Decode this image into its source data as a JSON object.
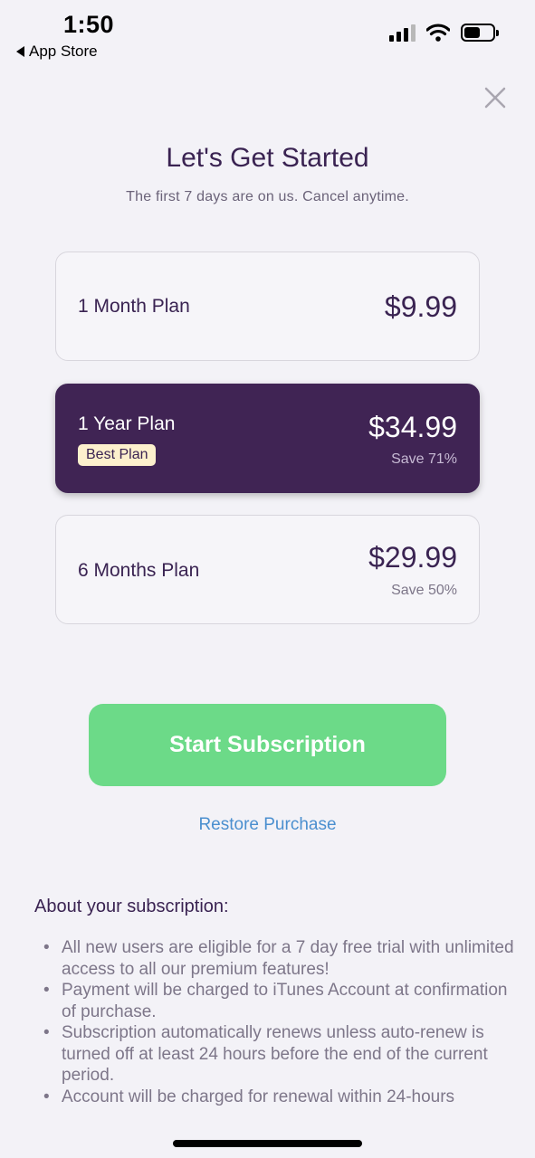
{
  "status_bar": {
    "time": "1:50",
    "back_label": "App Store"
  },
  "icons": {
    "back": "back-triangle-icon",
    "signal": "cellular-signal-icon",
    "wifi": "wifi-icon",
    "battery": "battery-icon",
    "close": "close-icon"
  },
  "header": {
    "title": "Let's Get Started",
    "subtitle": "The first 7 days are on us. Cancel anytime."
  },
  "plans": [
    {
      "name": "1 Month Plan",
      "price": "$9.99",
      "save": "",
      "badge": "",
      "selected": false
    },
    {
      "name": "1 Year Plan",
      "price": "$34.99",
      "save": "Save 71%",
      "badge": "Best Plan",
      "selected": true
    },
    {
      "name": "6 Months Plan",
      "price": "$29.99",
      "save": "Save 50%",
      "badge": "",
      "selected": false
    }
  ],
  "actions": {
    "start_label": "Start Subscription",
    "restore_label": "Restore Purchase"
  },
  "about": {
    "title": "About your subscription:",
    "items": [
      "All new users are eligible for a 7 day free trial with unlimited access to all our premium features!",
      "Payment will be charged to iTunes Account at confirmation of purchase.",
      "Subscription automatically renews unless auto-renew is turned off at least 24 hours before the end of the current period.",
      "Account will be charged for renewal within 24-hours"
    ]
  },
  "colors": {
    "brand_purple": "#402454",
    "cta_green": "#6cda88",
    "link_blue": "#4b8fcf",
    "badge_bg": "#fdf0cd",
    "background": "#f3f2f7"
  }
}
